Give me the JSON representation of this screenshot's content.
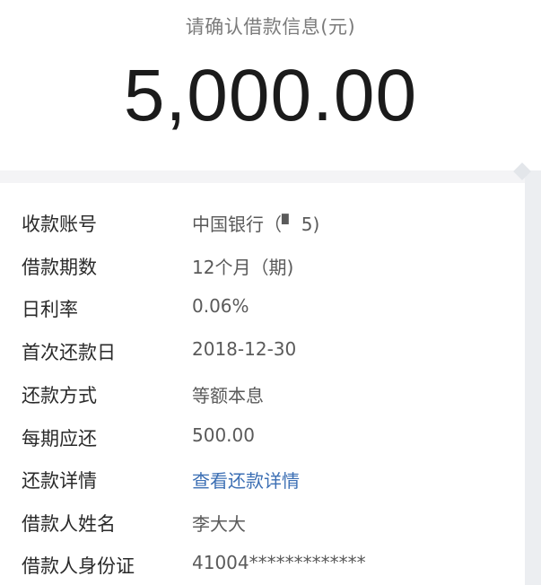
{
  "header": {
    "label": "请确认借款信息(元)",
    "amount": "5,000.00"
  },
  "details": [
    {
      "label": "收款账号",
      "value": "中国银行（▘ 5)",
      "is_link": false
    },
    {
      "label": "借款期数",
      "value": "12个月（期)",
      "is_link": false
    },
    {
      "label": "日利率",
      "value": "0.06%",
      "is_link": false
    },
    {
      "label": "首次还款日",
      "value": "2018-12-30",
      "is_link": false
    },
    {
      "label": "还款方式",
      "value": "等额本息",
      "is_link": false
    },
    {
      "label": "每期应还",
      "value": "500.00",
      "is_link": false
    },
    {
      "label": "还款详情",
      "value": "查看还款详情",
      "is_link": true
    },
    {
      "label": "借款人姓名",
      "value": "李大大",
      "is_link": false
    },
    {
      "label": "借款人身份证",
      "value": "41004*************",
      "is_link": false
    }
  ],
  "colors": {
    "link": "#3c6fb4",
    "background": "#f4f4f6"
  }
}
